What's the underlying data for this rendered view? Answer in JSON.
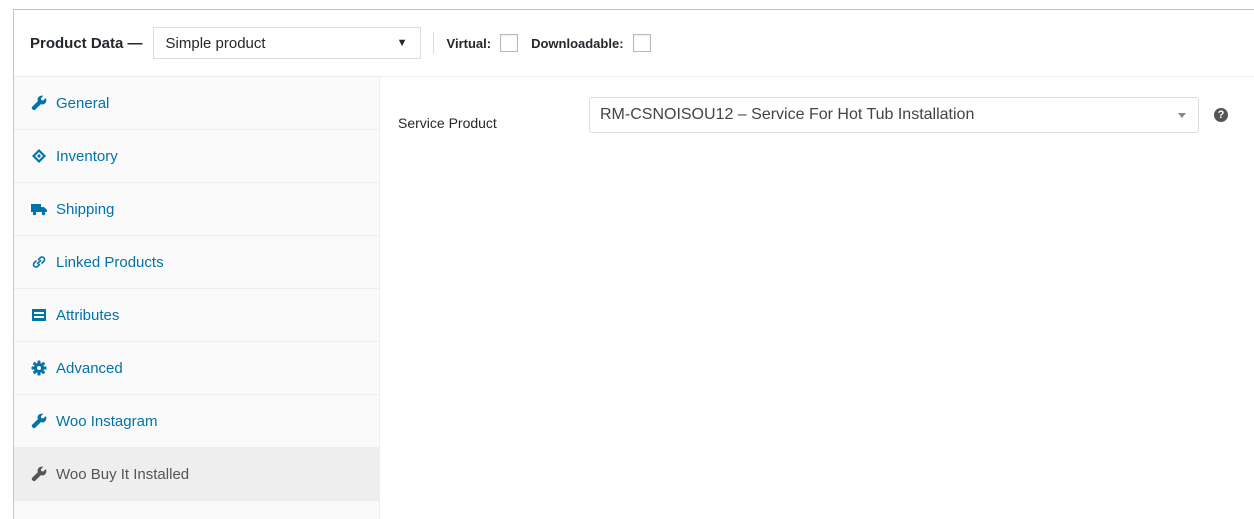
{
  "header": {
    "title": "Product Data —",
    "product_type": "Simple product",
    "virtual_label": "Virtual:",
    "downloadable_label": "Downloadable:",
    "virtual_checked": false,
    "downloadable_checked": false
  },
  "tabs": [
    {
      "label": "General",
      "icon": "wrench-icon",
      "active": false
    },
    {
      "label": "Inventory",
      "icon": "tag-icon",
      "active": false
    },
    {
      "label": "Shipping",
      "icon": "truck-icon",
      "active": false
    },
    {
      "label": "Linked Products",
      "icon": "link-icon",
      "active": false
    },
    {
      "label": "Attributes",
      "icon": "list-icon",
      "active": false
    },
    {
      "label": "Advanced",
      "icon": "gear-icon",
      "active": false
    },
    {
      "label": "Woo Instagram",
      "icon": "wrench-icon",
      "active": false
    },
    {
      "label": "Woo Buy It Installed",
      "icon": "wrench-icon",
      "active": true
    }
  ],
  "main": {
    "field_label": "Service Product",
    "selected_service": "RM-CSNOISOU12 – Service For Hot Tub Installation",
    "help_icon": "question-icon"
  },
  "colors": {
    "link": "#0073aa",
    "active_tab_bg": "#eeeeee",
    "sidebar_bg": "#fafafa"
  }
}
